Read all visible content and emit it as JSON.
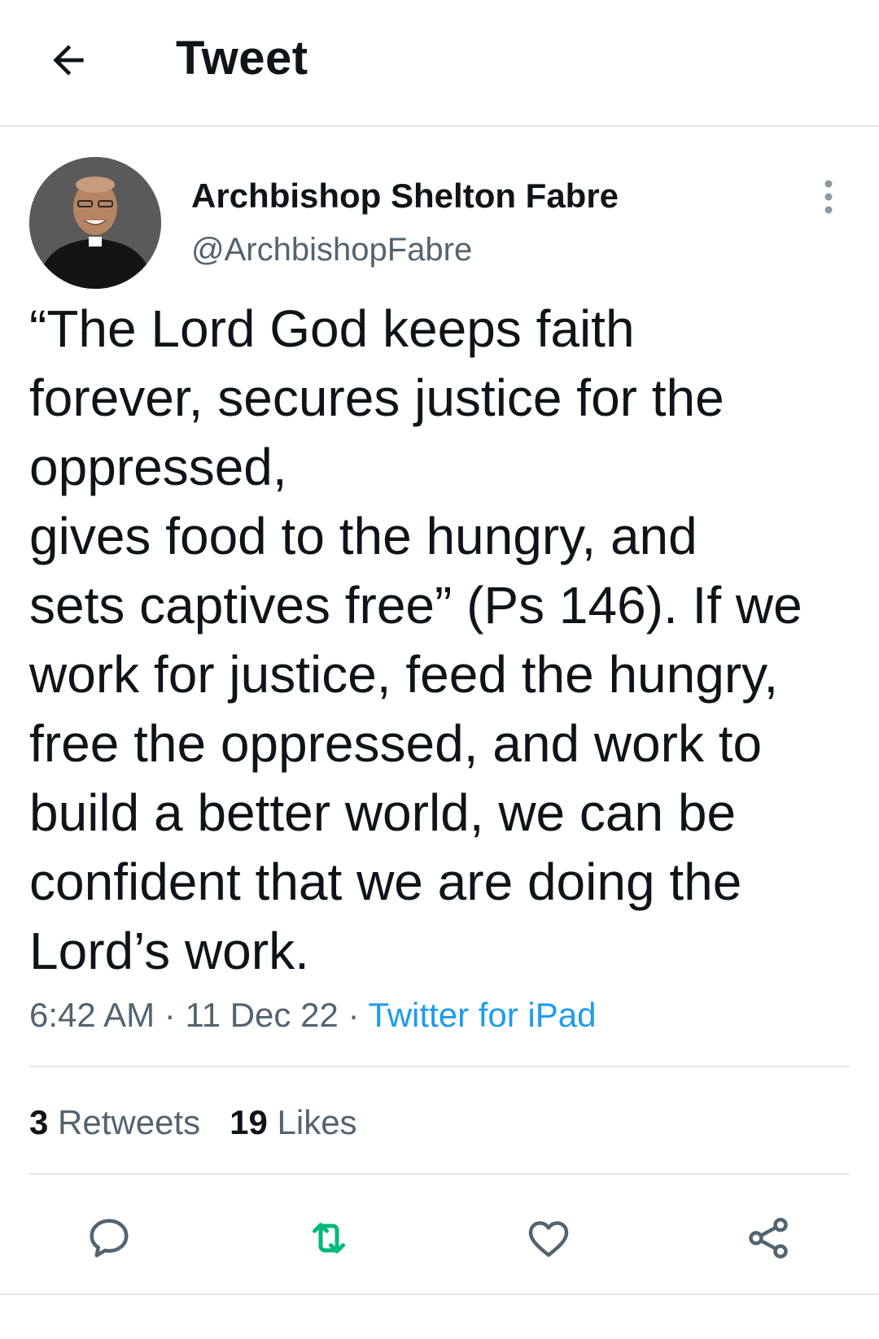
{
  "header": {
    "title": "Tweet",
    "back_icon": "arrow-left-icon"
  },
  "tweet": {
    "author": {
      "name": "Archbishop Shelton Fabre",
      "handle": "@ArchbishopFabre"
    },
    "text": "“The Lord God keeps faith\nforever, secures justice for the\noppressed,\ngives food to the hungry, and\nsets captives free” (Ps 146). If we\nwork for justice, feed the hungry,\nfree the oppressed, and work to\nbuild a better world, we can be\nconfident that we are doing the\nLord’s work.",
    "time": "6:42 AM",
    "date": "11 Dec 22",
    "separator": "·",
    "source": "Twitter for iPad",
    "retweets_count": "3",
    "retweets_label": "Retweets",
    "likes_count": "19",
    "likes_label": "Likes"
  },
  "actions": [
    {
      "icon": "reply-icon"
    },
    {
      "icon": "retweet-icon"
    },
    {
      "icon": "like-icon"
    },
    {
      "icon": "share-icon"
    }
  ],
  "colors": {
    "text": "#0f1419",
    "secondary": "#536471",
    "link": "#1d9bf0",
    "retweet": "#00ba7c",
    "divider": "#e6e9ec"
  }
}
